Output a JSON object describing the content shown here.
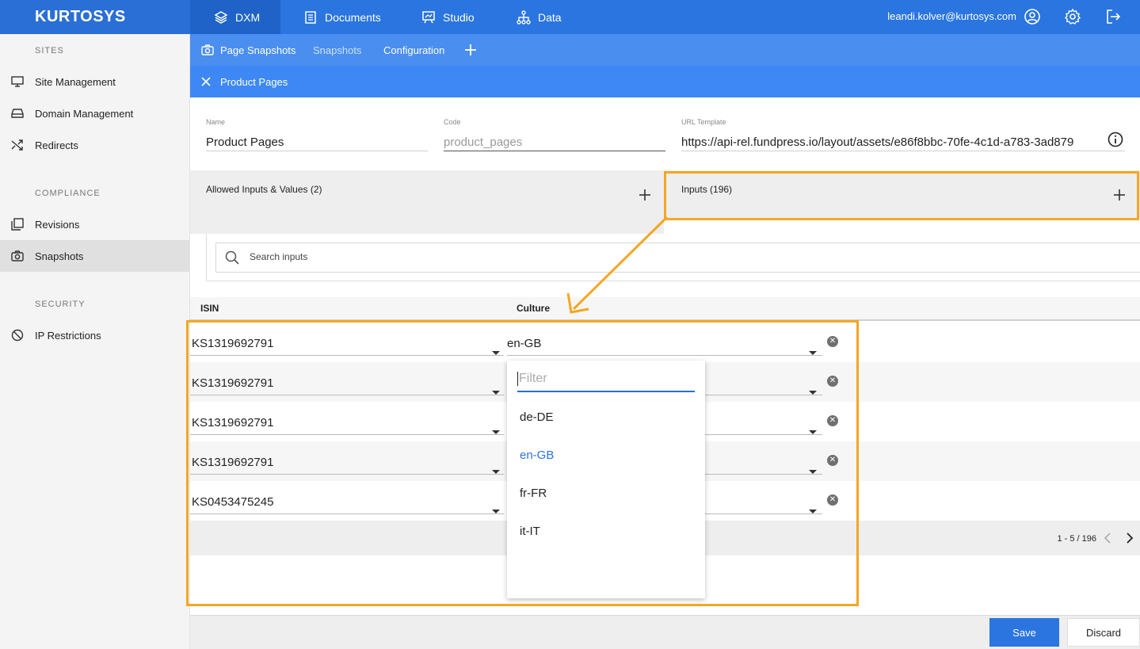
{
  "brand": "KURTOSYS",
  "topnav": {
    "items": [
      {
        "label": "DXM",
        "icon": "layers-icon"
      },
      {
        "label": "Documents",
        "icon": "document-icon"
      },
      {
        "label": "Studio",
        "icon": "studio-icon"
      },
      {
        "label": "Data",
        "icon": "data-tree-icon"
      }
    ],
    "user_email": "leandi.kolver@kurtosys.com"
  },
  "subnav": {
    "items": [
      {
        "label": "Page Snapshots"
      },
      {
        "label": "Snapshots"
      },
      {
        "label": "Configuration"
      }
    ]
  },
  "tab": {
    "label": "Product Pages"
  },
  "sidebar": {
    "sections": [
      {
        "title": "SITES",
        "items": [
          "Site Management",
          "Domain Management",
          "Redirects"
        ]
      },
      {
        "title": "COMPLIANCE",
        "items": [
          "Revisions",
          "Snapshots"
        ]
      },
      {
        "title": "SECURITY",
        "items": [
          "IP Restrictions"
        ]
      }
    ]
  },
  "form": {
    "name_label": "Name",
    "name_value": "Product Pages",
    "code_label": "Code",
    "code_value": "product_pages",
    "url_label": "URL Template",
    "url_value": "https://api-rel.fundpress.io/layout/assets/e86f8bbc-70fe-4c1d-a783-3ad879"
  },
  "panels": {
    "allowed": "Allowed Inputs & Values (2)",
    "inputs": "Inputs (196)"
  },
  "search": {
    "placeholder": "Search inputs"
  },
  "table": {
    "headers": [
      "ISIN",
      "Culture"
    ],
    "rows": [
      {
        "isin": "KS1319692791",
        "culture": "en-GB"
      },
      {
        "isin": "KS1319692791",
        "culture": ""
      },
      {
        "isin": "KS1319692791",
        "culture": ""
      },
      {
        "isin": "KS1319692791",
        "culture": ""
      },
      {
        "isin": "KS0453475245",
        "culture": ""
      }
    ]
  },
  "pager": {
    "range": "1 - 5 / 196"
  },
  "dropdown": {
    "filter_placeholder": "Filter",
    "options": [
      "de-DE",
      "en-GB",
      "fr-FR",
      "it-IT"
    ],
    "selected": "en-GB"
  },
  "actions": {
    "save": "Save",
    "discard": "Discard"
  },
  "colors": {
    "primary": "#2a75e0",
    "annotation": "#f5a623"
  }
}
